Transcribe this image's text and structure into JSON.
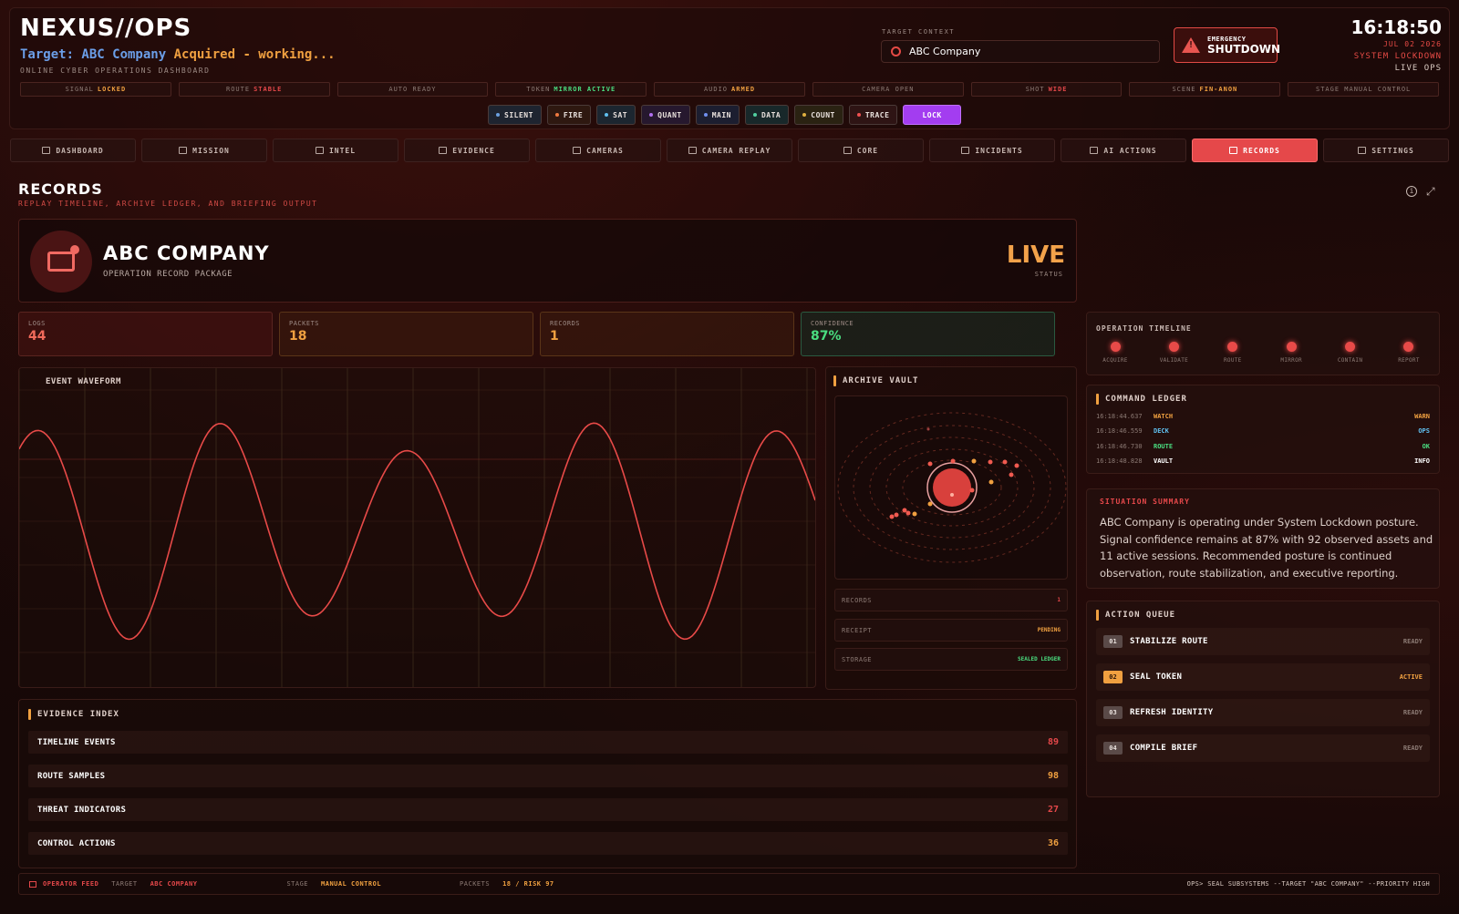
{
  "app": {
    "brand": "NEXUS//OPS",
    "target_prefix": "Target: ABC Company",
    "target_suffix": " Acquired - working...",
    "subtitle": "ONLINE CYBER OPERATIONS DASHBOARD"
  },
  "target_context": {
    "label": "TARGET CONTEXT",
    "value": "ABC Company"
  },
  "emergency": {
    "line1": "EMERGENCY",
    "line2": "SHUTDOWN"
  },
  "clock": {
    "time": "16:18:50",
    "date": "JUL 02 2026",
    "mode": "SYSTEM LOCKDOWN",
    "live": "LIVE OPS"
  },
  "status_bar": [
    {
      "label": "SIGNAL",
      "value": "LOCKED",
      "color": "#f0a040"
    },
    {
      "label": "ROUTE",
      "value": "STABLE",
      "color": "#e5484a"
    },
    {
      "label": "AUTO READY",
      "value": "",
      "color": "#8c7a74"
    },
    {
      "label": "TOKEN",
      "value": "MIRROR ACTIVE",
      "color": "#4ade80"
    },
    {
      "label": "AUDIO",
      "value": "ARMED",
      "color": "#f0a040"
    },
    {
      "label": "CAMERA OPEN",
      "value": "",
      "color": "#8c7a74"
    },
    {
      "label": "SHOT",
      "value": "WIDE",
      "color": "#e5484a"
    },
    {
      "label": "SCENE",
      "value": "FIN-ANON",
      "color": "#f0a040"
    },
    {
      "label": "STAGE MANUAL CONTROL",
      "value": "",
      "color": "#8c7a74"
    }
  ],
  "mode_chips": [
    {
      "label": "SILENT",
      "dot": "#6ba0e0",
      "bg": "#1e2430"
    },
    {
      "label": "FIRE",
      "dot": "#f07a40",
      "bg": "#2e1810"
    },
    {
      "label": "SAT",
      "dot": "#60c0f0",
      "bg": "#1c2630"
    },
    {
      "label": "QUANT",
      "dot": "#b070f0",
      "bg": "#26182e"
    },
    {
      "label": "MAIN",
      "dot": "#7090f0",
      "bg": "#1c1e30"
    },
    {
      "label": "DATA",
      "dot": "#50d0a0",
      "bg": "#18282a"
    },
    {
      "label": "COUNT",
      "dot": "#e0b040",
      "bg": "#2a2212"
    },
    {
      "label": "TRACE",
      "dot": "#f05050",
      "bg": "#2e1414"
    },
    {
      "label": "LOCK",
      "dot": "",
      "bg": "#a33df0"
    }
  ],
  "nav": [
    {
      "label": "DASHBOARD",
      "icon": "dashboard-icon"
    },
    {
      "label": "MISSION",
      "icon": "crosshair-icon"
    },
    {
      "label": "INTEL",
      "icon": "id-card-icon"
    },
    {
      "label": "EVIDENCE",
      "icon": "nodes-icon"
    },
    {
      "label": "CAMERAS",
      "icon": "camera-icon"
    },
    {
      "label": "CAMERA REPLAY",
      "icon": "camera-replay-icon"
    },
    {
      "label": "CORE",
      "icon": "signal-icon"
    },
    {
      "label": "INCIDENTS",
      "icon": "bell-icon"
    },
    {
      "label": "AI ACTIONS",
      "icon": "shield-icon"
    },
    {
      "label": "RECORDS",
      "icon": "folder-icon",
      "active": true
    },
    {
      "label": "SETTINGS",
      "icon": "sliders-icon"
    }
  ],
  "section": {
    "title": "RECORDS",
    "subtitle": "REPLAY TIMELINE, ARCHIVE LEDGER, AND BRIEFING OUTPUT"
  },
  "record": {
    "name": "ABC COMPANY",
    "package": "OPERATION RECORD PACKAGE",
    "state": "LIVE",
    "state_label": "STATUS"
  },
  "kpis": [
    {
      "label": "LOGS",
      "value": "44",
      "color": "#f06a5a"
    },
    {
      "label": "PACKETS",
      "value": "18",
      "color": "#f0a040"
    },
    {
      "label": "RECORDS",
      "value": "1",
      "color": "#f0a040"
    },
    {
      "label": "CONFIDENCE",
      "value": "87%",
      "color": "#4ade80"
    }
  ],
  "waveform": {
    "title": "EVENT WAVEFORM"
  },
  "vault": {
    "title": "ARCHIVE VAULT",
    "rows": [
      {
        "key": "RECORDS",
        "value": "1",
        "color": "#e5484a"
      },
      {
        "key": "RECEIPT",
        "value": "PENDING",
        "color": "#f0a040"
      },
      {
        "key": "STORAGE",
        "value": "SEALED LEDGER",
        "color": "#4ade80"
      }
    ]
  },
  "evidence": {
    "title": "EVIDENCE INDEX",
    "rows": [
      {
        "label": "TIMELINE EVENTS",
        "value": "89",
        "color": "#e5484a"
      },
      {
        "label": "ROUTE SAMPLES",
        "value": "98",
        "color": "#f0a040"
      },
      {
        "label": "THREAT INDICATORS",
        "value": "27",
        "color": "#e5484a"
      },
      {
        "label": "CONTROL ACTIONS",
        "value": "36",
        "color": "#f0a040"
      }
    ]
  },
  "timeline": {
    "title": "OPERATION TIMELINE",
    "steps": [
      "ACQUIRE",
      "VALIDATE",
      "ROUTE",
      "MIRROR",
      "CONTAIN",
      "REPORT"
    ]
  },
  "ledger": {
    "title": "COMMAND LEDGER",
    "rows": [
      {
        "time": "16:18:44.637",
        "event": "WATCH",
        "event_color": "#f0a040",
        "level": "WARN",
        "level_color": "#f0a040"
      },
      {
        "time": "16:18:46.559",
        "event": "DECK",
        "event_color": "#60c0f0",
        "level": "OPS",
        "level_color": "#60c0f0"
      },
      {
        "time": "16:18:46.730",
        "event": "ROUTE",
        "event_color": "#4ade80",
        "level": "OK",
        "level_color": "#4ade80"
      },
      {
        "time": "16:18:48.828",
        "event": "VAULT",
        "event_color": "#ffffff",
        "level": "INFO",
        "level_color": "#ffffff"
      }
    ]
  },
  "situation": {
    "title": "SITUATION SUMMARY",
    "body": "ABC Company is operating under System Lockdown posture. Signal confidence remains at 87% with 92 observed assets and 11 active sessions. Recommended posture is continued observation, route stabilization, and executive reporting."
  },
  "action_queue": {
    "title": "ACTION QUEUE",
    "rows": [
      {
        "num": "01",
        "label": "STABILIZE ROUTE",
        "state": "READY",
        "num_bg": "#5a4a48",
        "num_color": "#e8e0dc",
        "state_color": "#8c7a74"
      },
      {
        "num": "02",
        "label": "SEAL TOKEN",
        "state": "ACTIVE",
        "num_bg": "#f0a040",
        "num_color": "#2a1408",
        "state_color": "#f0a040"
      },
      {
        "num": "03",
        "label": "REFRESH IDENTITY",
        "state": "READY",
        "num_bg": "#5a4a48",
        "num_color": "#e8e0dc",
        "state_color": "#8c7a74"
      },
      {
        "num": "04",
        "label": "COMPILE BRIEF",
        "state": "READY",
        "num_bg": "#5a4a48",
        "num_color": "#e8e0dc",
        "state_color": "#8c7a74"
      }
    ]
  },
  "footer": {
    "feed": "OPERATOR FEED",
    "target_label": "TARGET",
    "target_value": "ABC COMPANY",
    "stage_label": "STAGE",
    "stage_value": "MANUAL CONTROL",
    "packets_label": "PACKETS",
    "packets_value": "18 / RISK 97",
    "command": "OPS> SEAL SUBSYSTEMS --TARGET \"ABC COMPANY\" --PRIORITY HIGH"
  }
}
